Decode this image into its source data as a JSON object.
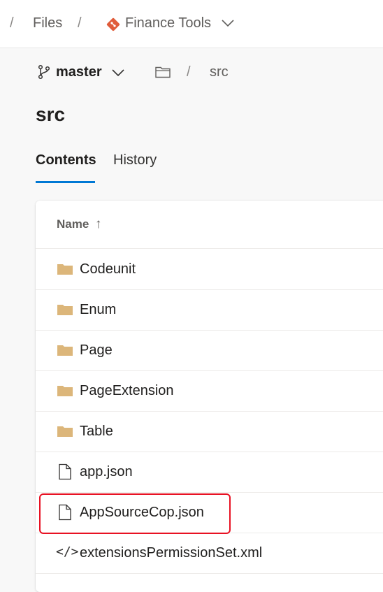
{
  "header": {
    "breadcrumb_sep": "/",
    "files_label": "Files",
    "repo_name": "Finance Tools",
    "repo_logo_color": "#e05c3a"
  },
  "branch": {
    "name": "master",
    "path_sep": "/",
    "path": "src"
  },
  "page_title": "src",
  "tabs": [
    {
      "label": "Contents",
      "selected": true
    },
    {
      "label": "History",
      "selected": false
    }
  ],
  "accent_color": "#0078d4",
  "file_list": {
    "column_name": "Name",
    "sort_indicator": "↑",
    "items": [
      {
        "name": "Codeunit",
        "type": "folder"
      },
      {
        "name": "Enum",
        "type": "folder"
      },
      {
        "name": "Page",
        "type": "folder"
      },
      {
        "name": "PageExtension",
        "type": "folder"
      },
      {
        "name": "Table",
        "type": "folder"
      },
      {
        "name": "app.json",
        "type": "file"
      },
      {
        "name": "AppSourceCop.json",
        "type": "file",
        "highlighted": true
      },
      {
        "name": "extensionsPermissionSet.xml",
        "type": "code-file",
        "glyph": "</>"
      }
    ]
  },
  "folder_color": "#dcb67a",
  "highlight_color": "#e81123"
}
